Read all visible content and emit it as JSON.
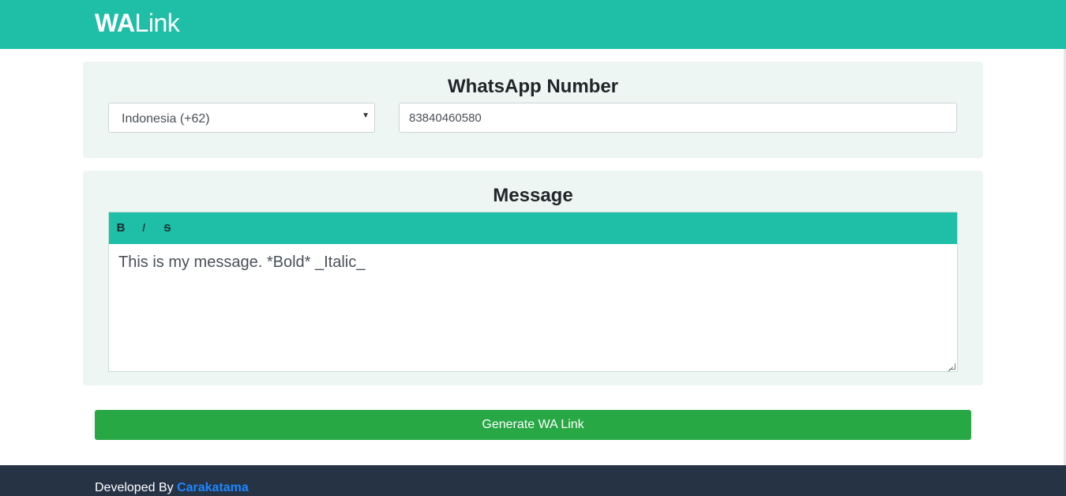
{
  "header": {
    "brand_bold": "WA",
    "brand_light": "Link"
  },
  "number_section": {
    "title": "WhatsApp Number",
    "country_selected": "Indonesia (+62)",
    "phone_value": "83840460580"
  },
  "message_section": {
    "title": "Message",
    "toolbar": {
      "bold_label": "B",
      "italic_label": "I",
      "strike_label": "S"
    },
    "message_value": "This is my message. *Bold*  _Italic_"
  },
  "actions": {
    "generate_label": "Generate WA Link"
  },
  "footer": {
    "prefix": "Developed By ",
    "author": "Carakatama"
  },
  "colors": {
    "primary": "#1fbea6",
    "success": "#28a745",
    "footer_bg": "#263345",
    "link": "#1f86ff",
    "card_bg": "#edf6f2"
  }
}
